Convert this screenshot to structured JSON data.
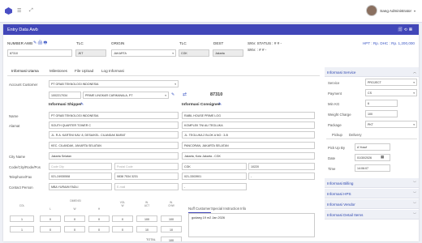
{
  "topbar": {
    "user_name": "Sang Administrator"
  },
  "page": {
    "title": "Entry Data Awb"
  },
  "header_fields": {
    "awb_label": "NUMBER AWB",
    "awb_value": "87310",
    "tlc1_label": "TLC",
    "tlc1_value": "JKT",
    "origin_label": "ORIGIN",
    "origin_value": "JAKARTA",
    "tlc2_label": "TLC",
    "tlc2_value": "CGK",
    "dest_label": "DEST",
    "dest_value": "Jakarta",
    "snv_status": "SNV. STATUS : # # -",
    "snv": "SNV. : # # -",
    "hpt": "HPT : Rp. DHC : Rp. 1,200,000"
  },
  "tabs": [
    "Informasi Utama",
    "Milestones",
    "File Upload",
    "Log Informasi"
  ],
  "customer": {
    "label": "Account Customer",
    "value": "PT GRAB TEKNOLOGI INDONESIA",
    "code": "1002217034",
    "name_select": "PRIME LINGKAR CARIKANALA, PT",
    "number": "87310"
  },
  "shipper": {
    "title": "Informasi Shipper",
    "name_label": "Name",
    "name": "PT GRAB TEKNOLOGI INDONESIA",
    "address_label": "Alamat",
    "addr1": "SOUTH QUARTER TOWER C",
    "addr2": "JL. R.A. KARTINI KAV. 8, DESA/KEL. CILANDAK BARAT",
    "addr3": "KEC. CILANDAK, JAKARTA SELATAN",
    "city_label": "City Name",
    "city": "Jakarta Selatan",
    "code_label": "Code/City/Rode/Pos",
    "code_ph": "Code City",
    "postal_ph": "Postal Code",
    "tel_label": "Telephone/Fax",
    "tel": "021-24930508",
    "fax": "0838 7534 3231",
    "contact_label": "Contact Person",
    "contact": "MBA YURA/M FADLI",
    "email_ph": "E-mail"
  },
  "consignee": {
    "title": "Informasi Consignee",
    "name": "RABIL HOUSE PRIME LOG",
    "addr1": "KOMPLEK TNI AU TEGLUKA",
    "addr2": "JL. TEGLUKA 2 BLOK A NO : 3-B",
    "addr3": "PANCORAN, JAKARTA SELATAN",
    "city": "Jakarta, Kota Jakarta - CGK",
    "code": "CGK",
    "postal": "10220",
    "tel": "021-3303901",
    "fax": "-",
    "contact": "-"
  },
  "dimensions": {
    "col_label": "COL",
    "dim_label": "DIMENSI",
    "l": "L",
    "w": "W",
    "h": "H",
    "vol": "VOL\nW",
    "act": "W.\nACT",
    "chw": "W.\nCHW",
    "rows": [
      [
        "1",
        "0",
        "0",
        "0",
        "0",
        "100",
        "100"
      ],
      [
        "1",
        "0",
        "0",
        "0",
        "0",
        "10",
        "10"
      ]
    ],
    "total_label": "TOTAL",
    "total": "100"
  },
  "notes_tabs": [
    "Nuff Customer",
    "Special Instruction",
    "Info"
  ],
  "notes_text": "godaeg 19 m2 Jan 2026",
  "right_panel": {
    "info_service": "Informasi Service",
    "service_label": "Service",
    "service": "PROJECT",
    "payment_label": "Payment",
    "payment": "CS",
    "min_kg_label": "Min KG",
    "min_kg": "6",
    "weight_label": "Weight Charge",
    "weight": "100",
    "package_label": "Package",
    "package": "PKT",
    "sub_tabs": [
      "Pickup",
      "Delivery"
    ],
    "pickup_by_label": "Pick Up By",
    "pickup_by": "A Yusuf",
    "date_label": "Date",
    "date": "01/30/2026",
    "time_label": "Time",
    "time": "14:06:07",
    "billing": "Informasi Billing",
    "hps": "Informasi HPS",
    "vendor": "Informasi Vendor",
    "items": "Informasi Detail Items"
  }
}
